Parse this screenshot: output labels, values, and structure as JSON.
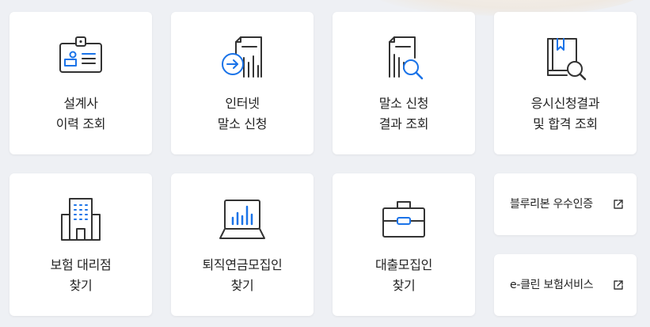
{
  "colors": {
    "icon_stroke": "#333333",
    "accent": "#1a73e8",
    "background": "#eef0f4",
    "card": "#ffffff"
  },
  "tiles": [
    {
      "icon": "id-card-icon",
      "line1": "설계사",
      "line2": "이력 조회"
    },
    {
      "icon": "document-arrow-icon",
      "line1": "인터넷",
      "line2": "말소 신청"
    },
    {
      "icon": "document-search-icon",
      "line1": "말소 신청",
      "line2": "결과 조회"
    },
    {
      "icon": "book-search-icon",
      "line1": "응시신청결과",
      "line2": "및 합격 조회"
    },
    {
      "icon": "building-icon",
      "line1": "보험 대리점",
      "line2": "찾기"
    },
    {
      "icon": "laptop-chart-icon",
      "line1": "퇴직연금모집인",
      "line2": "찾기"
    },
    {
      "icon": "briefcase-icon",
      "line1": "대출모집인",
      "line2": "찾기"
    }
  ],
  "links": [
    {
      "label": "블루리본 우수인증",
      "icon": "external-link-icon"
    },
    {
      "label": "e-클린 보험서비스",
      "icon": "external-link-icon"
    }
  ]
}
